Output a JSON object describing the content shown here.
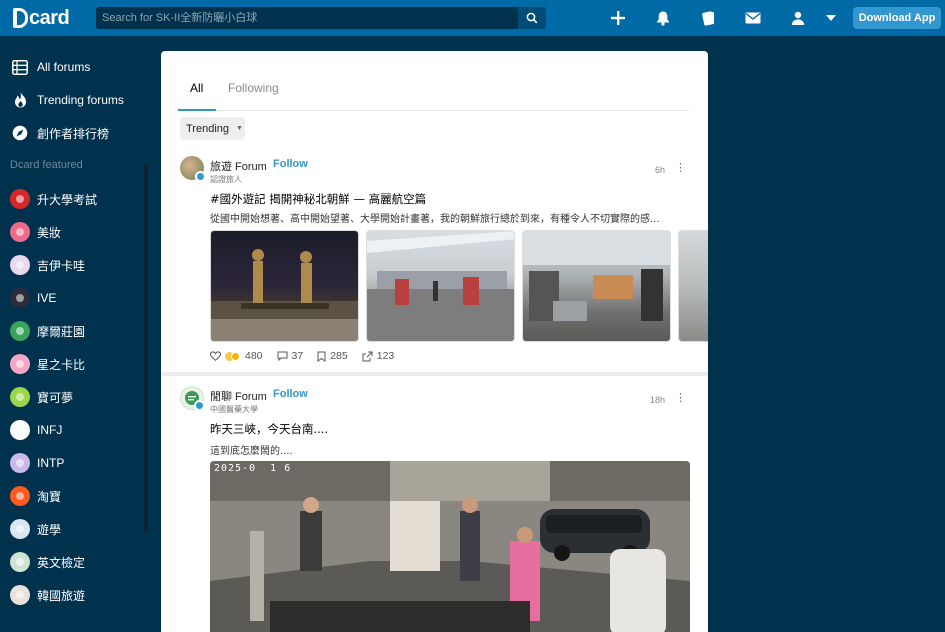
{
  "header": {
    "logo_text": "card",
    "search_placeholder": "Search for SK-II全新防曬小白球",
    "download_label": "Download App",
    "icons": [
      "search-icon",
      "plus-icon",
      "bell-icon",
      "cards-icon",
      "mail-icon",
      "user-icon",
      "chevron-down-icon"
    ]
  },
  "sidebar": {
    "main_items": [
      {
        "label": "All forums",
        "icon": "list-icon"
      },
      {
        "label": "Trending forums",
        "icon": "flame-icon"
      },
      {
        "label": "創作者排行榜",
        "icon": "compass-icon"
      }
    ],
    "section_title": "Dcard featured",
    "featured": [
      {
        "label": "升大學考試",
        "icon": "exam-icon",
        "color": "#d62828"
      },
      {
        "label": "美妝",
        "icon": "makeup-icon",
        "color": "#f06a8a"
      },
      {
        "label": "吉伊卡哇",
        "icon": "chiikawa-icon",
        "color": "#e8d9ef"
      },
      {
        "label": "IVE",
        "icon": "ive-icon",
        "color": "#2c2c3a"
      },
      {
        "label": "摩爾莊園",
        "icon": "mole-icon",
        "color": "#3aa55a"
      },
      {
        "label": "星之卡比",
        "icon": "kirby-icon",
        "color": "#f4a6c6"
      },
      {
        "label": "寶可夢",
        "icon": "pokemon-icon",
        "color": "#9bd64b"
      },
      {
        "label": "INFJ",
        "icon": "infj-icon",
        "color": "#ffffff"
      },
      {
        "label": "INTP",
        "icon": "intp-icon",
        "color": "#c9b8e8"
      },
      {
        "label": "淘寶",
        "icon": "taobao-icon",
        "color": "#ff5a1f"
      },
      {
        "label": "遊學",
        "icon": "study-abroad-icon",
        "color": "#d8e6f2"
      },
      {
        "label": "英文檢定",
        "icon": "english-test-icon",
        "color": "#cfe3d2"
      },
      {
        "label": "韓國旅遊",
        "icon": "korea-travel-icon",
        "color": "#e9e2d8"
      }
    ]
  },
  "tabs": [
    {
      "label": "All",
      "active": true
    },
    {
      "label": "Following",
      "active": false
    }
  ],
  "sort": {
    "label": "Trending"
  },
  "posts": [
    {
      "forum": "旅遊 Forum",
      "follow_label": "Follow",
      "author": "認證旅人",
      "time": "6h",
      "title": "#國外遊記 揭開神秘北朝鮮 — 高麗航空篇",
      "excerpt": "從國中開始想著、高中開始望著、大學開始計畫著，我的朝鮮旅行總於到來，有種令人不切實際的感...",
      "reactions": "480",
      "comments": "37",
      "saves": "285",
      "shares": "123"
    },
    {
      "forum": "閒聊 Forum",
      "follow_label": "Follow",
      "author": "中國醫藥大學",
      "time": "18h",
      "title": "昨天三峽，今天台南....",
      "excerpt": "這到底怎麼鬧的....",
      "image_timestamp": "2025-0  1 6"
    }
  ]
}
